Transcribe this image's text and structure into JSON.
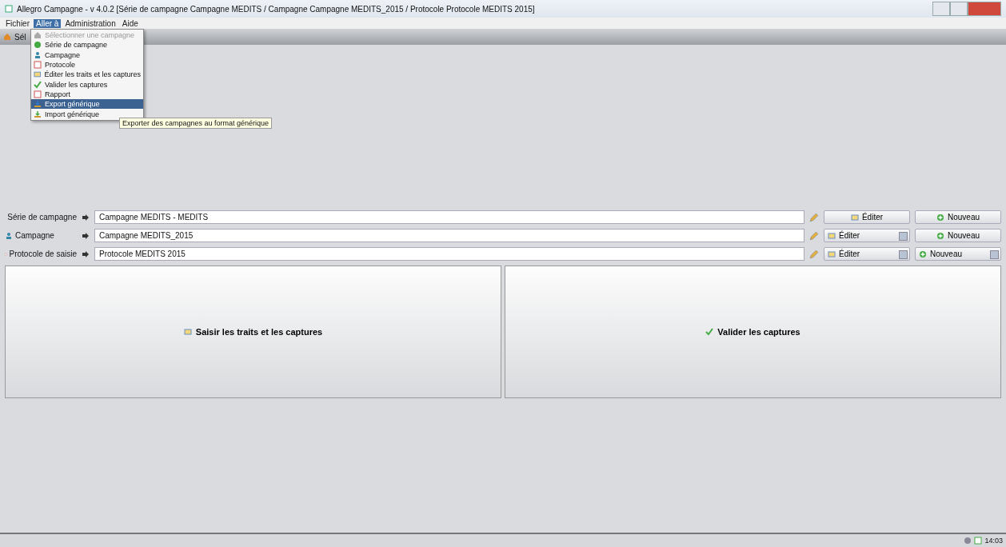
{
  "window": {
    "title": "Allegro Campagne - v 4.0.2 [Série de campagne Campagne MEDITS / Campagne Campagne MEDITS_2015 / Protocole Protocole MEDITS 2015]"
  },
  "menubar": [
    {
      "label": "Fichier",
      "selected": false
    },
    {
      "label": "Aller à",
      "selected": true
    },
    {
      "label": "Administration",
      "selected": false
    },
    {
      "label": "Aide",
      "selected": false
    }
  ],
  "toolbar": {
    "tab_label": "Sél"
  },
  "menu": {
    "items": [
      {
        "label": "Sélectionner une campagne",
        "disabled": true,
        "selected": false
      },
      {
        "label": "Série de campagne",
        "disabled": false,
        "selected": false
      },
      {
        "label": "Campagne",
        "disabled": false,
        "selected": false
      },
      {
        "label": "Protocole",
        "disabled": false,
        "selected": false
      },
      {
        "label": "Éditer les traits et les captures",
        "disabled": false,
        "selected": false
      },
      {
        "label": "Valider les captures",
        "disabled": false,
        "selected": false
      },
      {
        "label": "Rapport",
        "disabled": false,
        "selected": false
      },
      {
        "label": "Export générique",
        "disabled": false,
        "selected": true
      },
      {
        "label": "Import générique",
        "disabled": false,
        "selected": false
      }
    ]
  },
  "tooltip": "Exporter des campagnes au format générique",
  "rows": [
    {
      "label": "Série de campagne",
      "value": "Campagne MEDITS - MEDITS",
      "edit": {
        "label": "Éditer",
        "dropdown": false
      },
      "new": {
        "label": "Nouveau",
        "dropdown": false
      }
    },
    {
      "label": "Campagne",
      "value": "Campagne MEDITS_2015",
      "edit": {
        "label": "Éditer",
        "dropdown": true
      },
      "new": {
        "label": "Nouveau",
        "dropdown": false
      }
    },
    {
      "label": "Protocole de saisie",
      "value": "Protocole MEDITS 2015",
      "edit": {
        "label": "Éditer",
        "dropdown": true
      },
      "new": {
        "label": "Nouveau",
        "dropdown": true
      }
    }
  ],
  "actions": [
    {
      "label": "Saisir les traits et les captures"
    },
    {
      "label": "Valider les captures"
    }
  ],
  "status_bar": {
    "time": "14:03"
  }
}
